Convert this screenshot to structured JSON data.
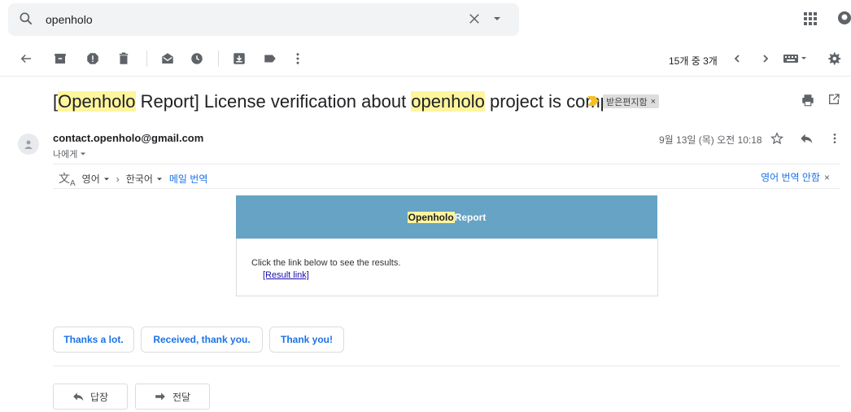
{
  "search": {
    "query_pre": "",
    "query_highlight": "",
    "query": "openholo"
  },
  "toolbar": {
    "page_count": "15개 중 3개"
  },
  "email": {
    "subject_parts": [
      "[",
      "Openholo",
      " Report] License verification about ",
      "openholo",
      " project is complete"
    ],
    "label": "받은편지함",
    "sender": "contact.openholo@gmail.com",
    "recipient": "나에게",
    "date": "9월 13일 (목) 오전 10:18"
  },
  "translation": {
    "from_lang": "영어",
    "to_lang": "한국어",
    "translate_link": "메일 번역",
    "no_translate": "영어 번역 안함"
  },
  "card": {
    "header_highlight": "Openholo",
    "header_rest": " Report",
    "body_text": "Click the link below to see the results.",
    "link_text": "[Result link]"
  },
  "smart_replies": [
    "Thanks a lot.",
    "Received, thank you.",
    "Thank you!"
  ],
  "actions": {
    "reply": "답장",
    "forward": "전달"
  },
  "colors": {
    "accent": "#1a73e8",
    "card_header": "#66a3c4",
    "highlight": "#fff59d"
  }
}
